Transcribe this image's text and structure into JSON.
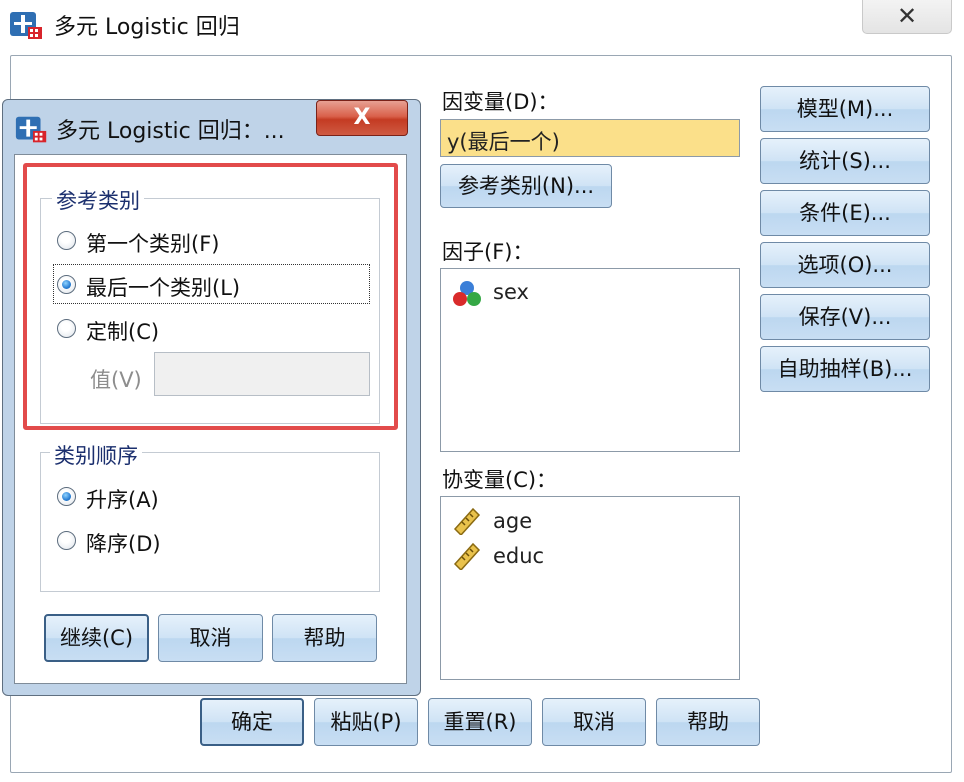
{
  "main_window": {
    "title": "多元 Logistic 回归",
    "close_glyph": "✕",
    "dependent": {
      "label": "因变量(D)：",
      "value": "y(最后一个)",
      "ref_button": "参考类别(N)..."
    },
    "factor": {
      "label": "因子(F)：",
      "items": [
        "sex"
      ]
    },
    "covariate": {
      "label": "协变量(C)：",
      "items": [
        "age",
        "educ"
      ]
    },
    "side_buttons": [
      "模型(M)...",
      "统计(S)...",
      "条件(E)...",
      "选项(O)...",
      "保存(V)...",
      "自助抽样(B)..."
    ],
    "bottom_buttons": [
      "确定",
      "粘贴(P)",
      "重置(R)",
      "取消",
      "帮助"
    ]
  },
  "sub_dialog": {
    "title": "多元 Logistic 回归：...",
    "close_glyph": "X",
    "reference_group": {
      "legend": "参考类别",
      "options": [
        "第一个类别(F)",
        "最后一个类别(L)",
        "定制(C)"
      ],
      "selected": "最后一个类别(L)",
      "value_label": "值(V)",
      "value": ""
    },
    "order_group": {
      "legend": "类别顺序",
      "options": [
        "升序(A)",
        "降序(D)"
      ],
      "selected": "升序(A)"
    },
    "buttons": [
      "继续(C)",
      "取消",
      "帮助"
    ]
  },
  "icons": {
    "app": "spss-app-icon",
    "nominal": "nominal-variable-icon",
    "scale": "scale-variable-icon"
  },
  "colors": {
    "dialog_frame": "#bfd3e8",
    "highlight": "#e24b4b",
    "selected_field": "#fbe08a",
    "close_button": "#c43b23"
  }
}
